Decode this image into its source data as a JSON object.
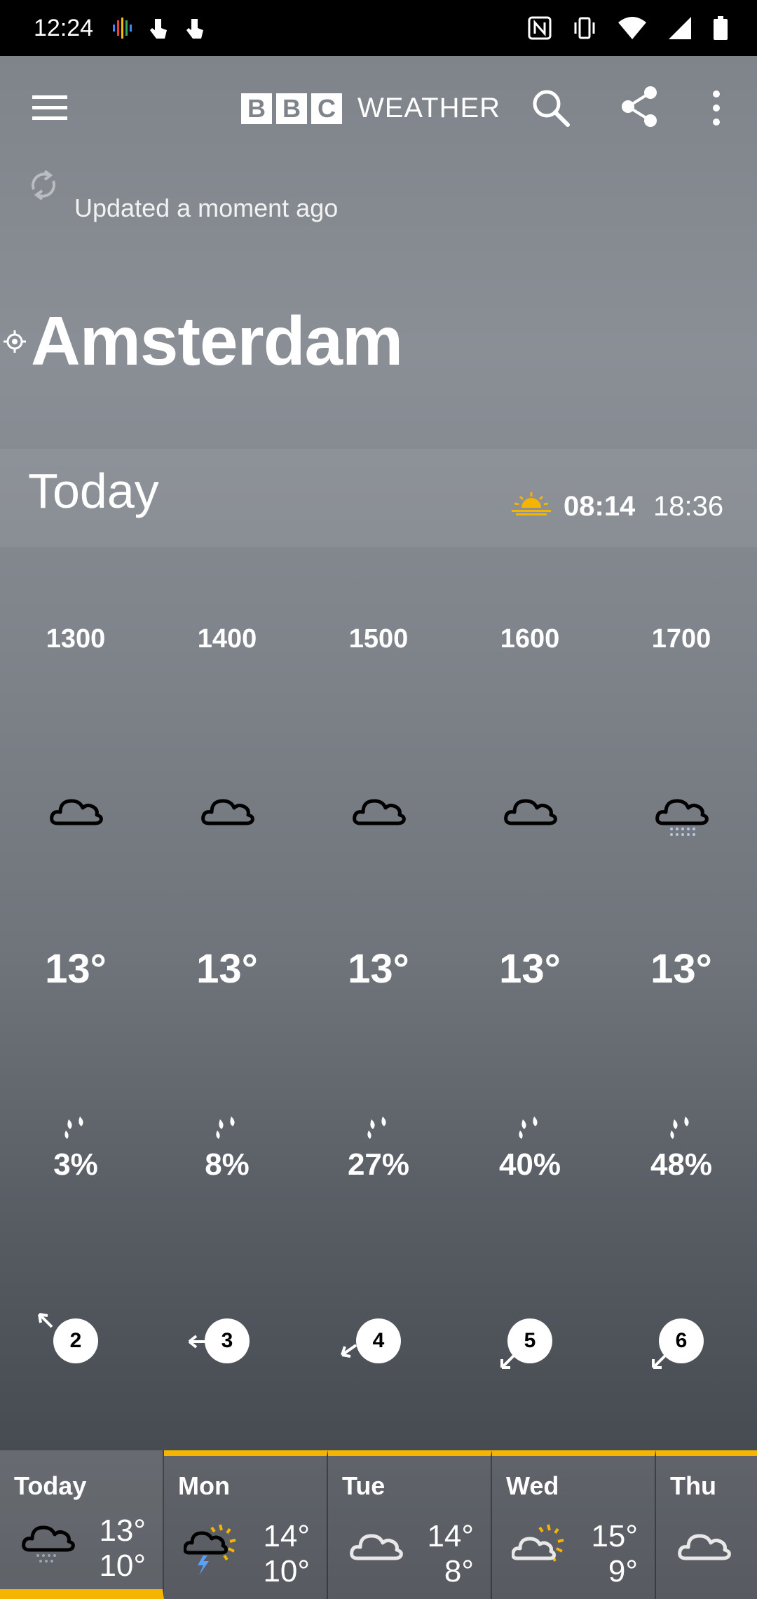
{
  "status_bar": {
    "time": "12:24"
  },
  "app_bar": {
    "logo_letters": [
      "B",
      "B",
      "C"
    ],
    "logo_word": "WEATHER"
  },
  "updated_text": "Updated a moment ago",
  "location": "Amsterdam",
  "today": {
    "label": "Today",
    "sunrise": "08:14",
    "sunset": "18:36"
  },
  "hourly": [
    {
      "hour": "1300",
      "icon": "cloud-icon",
      "temp": "13°",
      "precip": "3%",
      "wind": "2"
    },
    {
      "hour": "1400",
      "icon": "cloud-icon",
      "temp": "13°",
      "precip": "8%",
      "wind": "3"
    },
    {
      "hour": "1500",
      "icon": "cloud-icon",
      "temp": "13°",
      "precip": "27%",
      "wind": "4"
    },
    {
      "hour": "1600",
      "icon": "cloud-icon",
      "temp": "13°",
      "precip": "40%",
      "wind": "5"
    },
    {
      "hour": "1700",
      "icon": "drizzle-cloud-icon",
      "temp": "13°",
      "precip": "48%",
      "wind": "6"
    }
  ],
  "daily": [
    {
      "name": "Today",
      "icon": "drizzle-cloud-icon",
      "hi": "13°",
      "lo": "10°"
    },
    {
      "name": "Mon",
      "icon": "thunder-sun-cloud-icon",
      "hi": "14°",
      "lo": "10°"
    },
    {
      "name": "Tue",
      "icon": "cloud-icon",
      "hi": "14°",
      "lo": "8°"
    },
    {
      "name": "Wed",
      "icon": "sun-cloud-icon",
      "hi": "15°",
      "lo": "9°"
    },
    {
      "name": "Thu",
      "icon": "cloud-icon",
      "hi": "",
      "lo": ""
    }
  ],
  "colors": {
    "accent": "#f5b400",
    "background": "#7f848b"
  }
}
